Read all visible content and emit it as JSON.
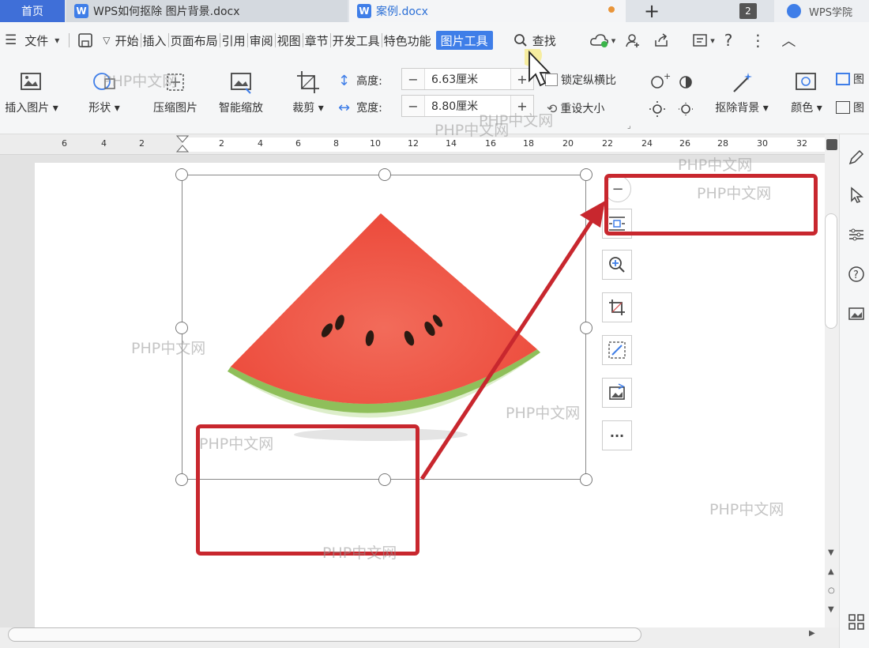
{
  "tabs": {
    "home": "首页",
    "doc1": "WPS如何抠除 图片背景.docx",
    "doc2": "案例.docx",
    "count": "2",
    "academy": "WPS学院"
  },
  "menu": {
    "file": "文件",
    "items": [
      "开始",
      "插入",
      "页面布局",
      "引用",
      "审阅",
      "视图",
      "章节",
      "开发工具",
      "特色功能"
    ],
    "active": "图片工具",
    "find": "查找"
  },
  "ribbon": {
    "insert_picture": "插入图片",
    "shape": "形状",
    "compress": "压缩图片",
    "smart_zoom": "智能缩放",
    "crop": "裁剪",
    "height_label": "高度:",
    "height_value": "6.63厘米",
    "width_label": "宽度:",
    "width_value": "8.80厘米",
    "lock_ratio": "锁定纵横比",
    "reset_size": "重设大小",
    "remove_bg": "抠除背景",
    "color": "颜色",
    "more_right": "图"
  },
  "ruler": {
    "left_ticks": [
      "6",
      "4",
      "2"
    ],
    "right_ticks": [
      "2",
      "4",
      "6",
      "8",
      "10",
      "12",
      "14",
      "16",
      "18",
      "20",
      "22",
      "24",
      "26",
      "28",
      "30",
      "32"
    ]
  },
  "watermarks": {
    "text": "PHP中文网"
  },
  "colors": {
    "accent": "#3f7ee8",
    "annotation": "#c8272e",
    "watermelon": "#ef4a3c",
    "rind": "#8fbf5a"
  }
}
